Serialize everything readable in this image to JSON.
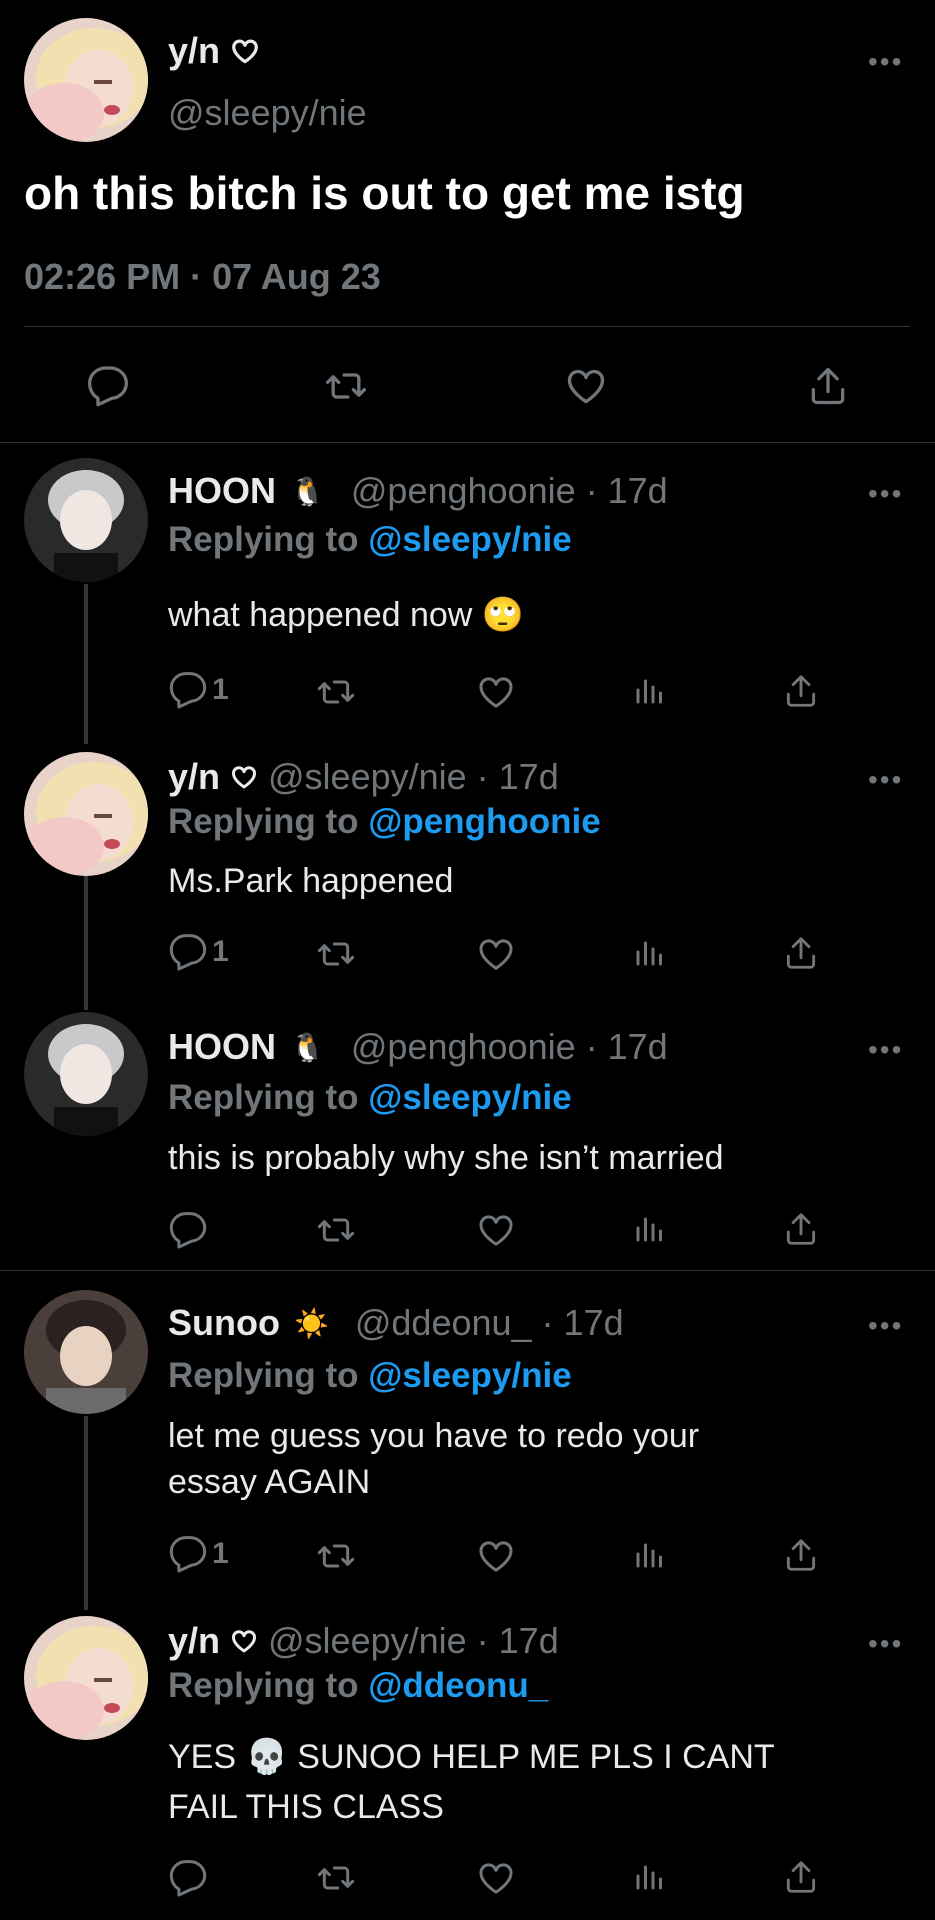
{
  "main_tweet": {
    "name": "y/n",
    "badge_icon": "heart-outline-icon",
    "handle": "@sleepy/nie",
    "text": "oh this bitch is out to get me istg",
    "timestamp": "02:26 PM · 07 Aug 23"
  },
  "replies": [
    {
      "name": "HOON",
      "emoji": "🐧",
      "handle_time": "@penghoonie · 17d",
      "replying_prefix": "Replying to ",
      "replying_to": "@sleepy/nie",
      "text": "what happened now 🙄",
      "reply_count": "1"
    },
    {
      "name": "y/n",
      "emoji": "heart-outline-icon",
      "handle_time": "@sleepy/nie · 17d",
      "replying_prefix": "Replying to ",
      "replying_to": "@penghoonie",
      "text": "Ms.Park happened",
      "reply_count": "1"
    },
    {
      "name": "HOON",
      "emoji": "🐧",
      "handle_time": "@penghoonie · 17d",
      "replying_prefix": "Replying to ",
      "replying_to": "@sleepy/nie",
      "text": "this is probably why she isn’t married",
      "reply_count": ""
    },
    {
      "name": "Sunoo",
      "emoji": "☀️",
      "handle_time": "@ddeonu_ · 17d",
      "replying_prefix": "Replying to ",
      "replying_to": "@sleepy/nie",
      "text_line1": "let me guess you have to redo your",
      "text_line2": "essay AGAIN",
      "reply_count": "1"
    },
    {
      "name": "y/n",
      "emoji": "heart-outline-icon",
      "handle_time": "@sleepy/nie · 17d",
      "replying_prefix": "Replying to ",
      "replying_to": "@ddeonu_",
      "text_line1": "YES 💀  SUNOO HELP ME PLS I CANT",
      "text_line2": "FAIL THIS CLASS",
      "reply_count": ""
    }
  ],
  "more_label": "•••",
  "colors": {
    "background": "#000000",
    "text": "#e7e9ea",
    "muted": "#71767b",
    "link": "#1d9bf0"
  }
}
